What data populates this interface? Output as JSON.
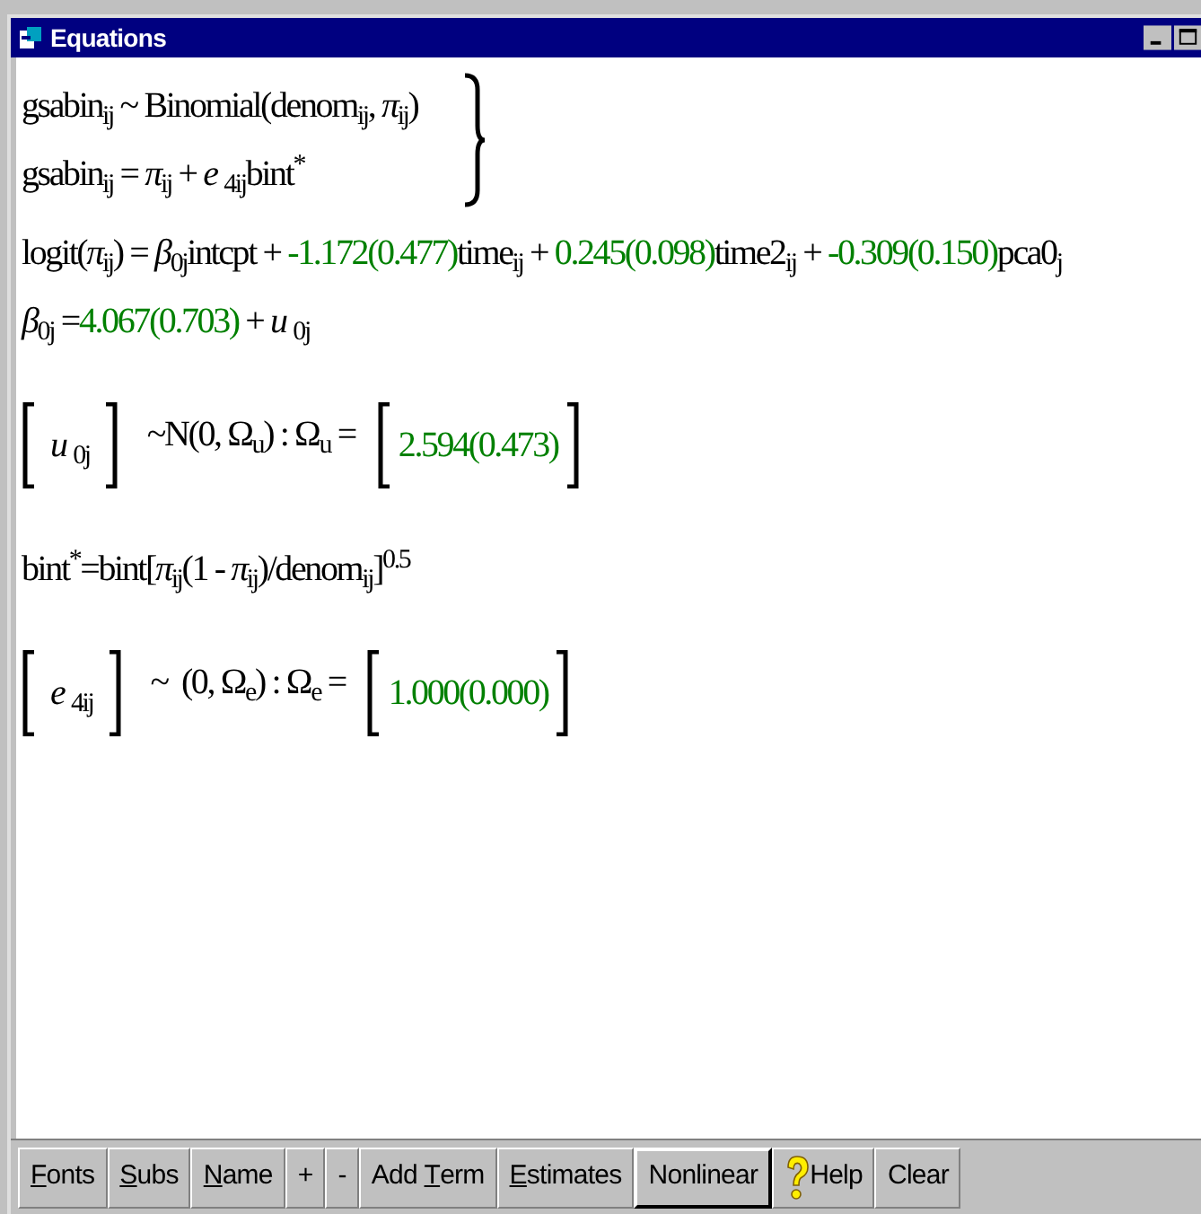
{
  "window": {
    "title": "Equations"
  },
  "equations": [
    {
      "kind": "braced",
      "lines": [
        [
          {
            "kind": "term",
            "text": "gsabin$_{ij}$ ~ Binomial(denom$_{ij}$, *π*$_{ij}$)"
          }
        ],
        [
          {
            "kind": "term",
            "text": "gsabin$_{ij}$ = *π*$_{ij}$ + *e* $_{4ij}$bint$^{*}$"
          }
        ]
      ]
    },
    {
      "kind": "line",
      "segments": [
        {
          "kind": "term",
          "text": "logit(*π*$_{ij}$) = *β*$_{0j}$intcpt + "
        },
        {
          "kind": "estimate",
          "text": "-1.172(0.477)"
        },
        {
          "kind": "term",
          "text": "time$_{ij}$ + "
        },
        {
          "kind": "estimate",
          "text": "0.245(0.098)"
        },
        {
          "kind": "term",
          "text": "time2$_{ij}$ + "
        },
        {
          "kind": "estimate",
          "text": "-0.309(0.150)"
        },
        {
          "kind": "term",
          "text": "pca0$_{j}$"
        }
      ]
    },
    {
      "kind": "line",
      "segments": [
        {
          "kind": "term",
          "text": "*β*$_{0j}$ ="
        },
        {
          "kind": "estimate",
          "text": "4.067(0.703)"
        },
        {
          "kind": "term",
          "text": " + *u* $_{0j}$"
        }
      ]
    },
    {
      "kind": "matrix",
      "vector": "*u* $_{0j}$",
      "distribution": "~N(0, Ω$_{u}$) : Ω$_{u}$ =",
      "value": "2.594(0.473)"
    },
    {
      "kind": "line",
      "segments": [
        {
          "kind": "term",
          "text": "bint$^{*}$=bint[*π*$_{ij}$(1 - *π*$_{ij}$)/denom$_{ij}$]$^{0.5}$"
        }
      ]
    },
    {
      "kind": "matrix",
      "vector": "*e* $_{4ij}$",
      "distribution": "~  (0, Ω$_{e}$) : Ω$_{e}$ =",
      "value": "1.000(0.000)"
    }
  ],
  "toolbar": [
    {
      "kind": "text",
      "key": "F",
      "after": "onts",
      "selected": false
    },
    {
      "kind": "text",
      "key": "S",
      "after": "ubs",
      "selected": false
    },
    {
      "kind": "text",
      "key": "N",
      "after": "ame",
      "selected": false
    },
    {
      "kind": "text",
      "after": "+",
      "selected": false
    },
    {
      "kind": "text",
      "after": "-",
      "selected": false
    },
    {
      "kind": "text",
      "before": "Add ",
      "key": "T",
      "after": "erm",
      "selected": false
    },
    {
      "kind": "text",
      "key": "E",
      "after": "stimates",
      "selected": false
    },
    {
      "kind": "text",
      "after": "Nonlinear",
      "selected": true
    },
    {
      "kind": "help",
      "after": "Help",
      "selected": false
    },
    {
      "kind": "text",
      "after": "Clear",
      "selected": false
    }
  ]
}
